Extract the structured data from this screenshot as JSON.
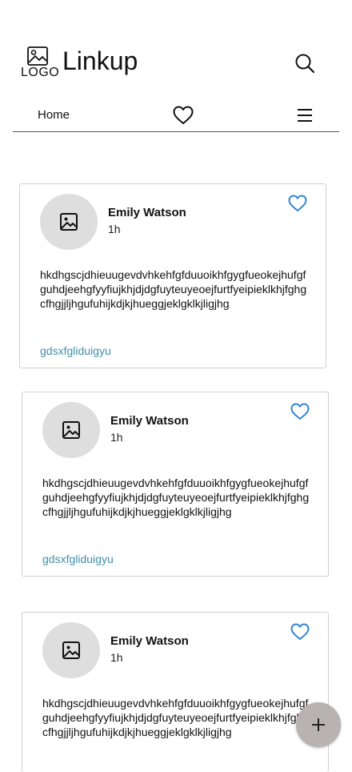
{
  "header": {
    "logo_text": "LOGO",
    "app_title": "Linkup"
  },
  "nav": {
    "home_label": "Home"
  },
  "posts": [
    {
      "author": "Emily Watson",
      "time": "1h",
      "text": "hkdhgscjdhieuugevdvhkehfgfduuoikhfgygfueokejhufgfguhdjeehgfyyfiujkhjdjdgfuyteuyeoejfurtfyeipieklkhjfghgcfhgjjljhgufuhijkdjkjhueggjeklgklkjligjhg",
      "link": "gdsxfgliduigyu"
    },
    {
      "author": "Emily Watson",
      "time": "1h",
      "text": "hkdhgscjdhieuugevdvhkehfgfduuoikhfgygfueokejhufgfguhdjeehgfyyfiujkhjdjdgfuyteuyeoejfurtfyeipieklkhjfghgcfhgjjljhgufuhijkdjkjhueggjeklgklkjligjhg",
      "link": "gdsxfgliduigyu"
    },
    {
      "author": "Emily Watson",
      "time": "1h",
      "text": "hkdhgscjdhieuugevdvhkehfgfduuoikhfgygfueokejhufgfguhdjeehgfyyfiujkhjdjdgfuyteuyeoejfurtfyeipieklkhjfghgcfhgjjljhgufuhijkdjkjhueggjeklgklkjligjhg"
    }
  ],
  "colors": {
    "accent": "#2f86d6",
    "link": "#3f8fa8",
    "fab": "#b8b2b3",
    "avatar_bg": "#dedede"
  },
  "icons": {
    "logo": "image-icon",
    "search": "search-icon",
    "nav_favorite": "heart-icon",
    "nav_menu": "hamburger-menu-icon",
    "post_like": "heart-outline-icon",
    "fab": "plus-icon"
  }
}
